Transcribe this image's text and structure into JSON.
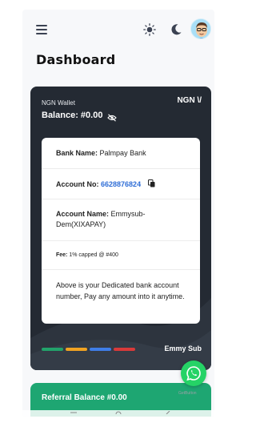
{
  "header": {
    "title": "Dashboard",
    "icons": [
      "menu-icon",
      "sun-icon",
      "moon-icon",
      "avatar"
    ]
  },
  "wallet": {
    "label": "NGN Wallet",
    "currency": "NGN \\/",
    "balance": "Balance: #0.00"
  },
  "account": {
    "bank_label": "Bank Name:",
    "bank_value": "Palmpay Bank",
    "acct_no_label": "Account No:",
    "acct_no_value": "6628876824",
    "acct_name_label": "Account Name:",
    "acct_name_value": "Emmysub-Dem(XIXAPAY)",
    "fee_label": "Fee:",
    "fee_value": "1% capped @ #400",
    "note": "Above is your Dedicated bank account number, Pay any amount into it anytime."
  },
  "brand": "Emmy Sub",
  "stripes": [
    "#22a36b",
    "#f0a322",
    "#3f7ee8",
    "#d93a3a"
  ],
  "referral": {
    "text": "Referral Balance #0.00"
  },
  "floating": {
    "getbutton": "GetButton"
  },
  "colors": {
    "card": "#242a33",
    "accent": "#2e6dd6",
    "referral": "#1ea672",
    "whatsapp": "#25d366"
  }
}
